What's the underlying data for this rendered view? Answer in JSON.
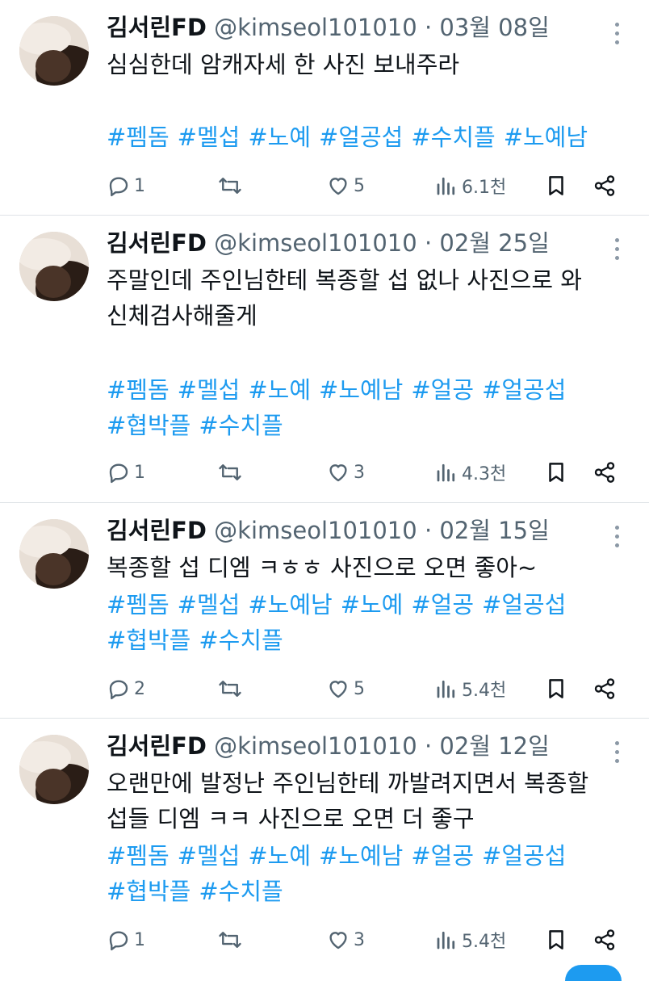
{
  "tweets": [
    {
      "name": "김서린FD",
      "handle": "@kimseol101010",
      "dot": "·",
      "date": "03월 08일",
      "text_lines": [
        "심심한데 암캐자세 한 사진 보내주라",
        ""
      ],
      "tags": [
        "#펨돔",
        "#멜섭",
        "#노예",
        "#얼공섭",
        "#수치플",
        "#노예남"
      ],
      "replies": "1",
      "retweets": "",
      "likes": "5",
      "views": "6.1천"
    },
    {
      "name": "김서린FD",
      "handle": "@kimseol101010",
      "dot": "·",
      "date": "02월 25일",
      "text_lines": [
        "주말인데 주인님한테 복종할 섭 없나 사진으로 와",
        "신체검사해줄게"
      ],
      "tags": [
        "#펨돔",
        "#멜섭",
        "#노예",
        "#노예남",
        "#얼공",
        "#얼공섭",
        "#협박플",
        "#수치플"
      ],
      "replies": "1",
      "retweets": "",
      "likes": "3",
      "views": "4.3천"
    },
    {
      "name": "김서린FD",
      "handle": "@kimseol101010",
      "dot": "·",
      "date": "02월 15일",
      "text_lines": [
        "복종할 섭 디엠 ㅋㅎㅎ 사진으로 오면 좋아~"
      ],
      "tags": [
        "#펨돔",
        "#멜섭",
        "#노예남",
        "#노예",
        "#얼공",
        "#얼공섭",
        "#협박플",
        "#수치플"
      ],
      "replies": "2",
      "retweets": "",
      "likes": "5",
      "views": "5.4천"
    },
    {
      "name": "김서린FD",
      "handle": "@kimseol101010",
      "dot": "·",
      "date": "02월 12일",
      "text_lines": [
        "오랜만에 발정난 주인님한테 까발려지면서 복종할",
        "섭들 디엠 ㅋㅋ 사진으로 오면 더 좋구"
      ],
      "tags": [
        "#펨돔",
        "#멜섭",
        "#노예",
        "#노예남",
        "#얼공",
        "#얼공섭",
        "#협박플",
        "#수치플"
      ],
      "replies": "1",
      "retweets": "",
      "likes": "3",
      "views": "5.4천"
    }
  ],
  "icons": {
    "reply": "reply-icon",
    "retweet": "retweet-icon",
    "like": "heart-icon",
    "views": "views-icon",
    "bookmark": "bookmark-icon",
    "share": "share-icon",
    "more": "more-icon"
  },
  "colors": {
    "hashtag": "#1d9bf0",
    "secondary": "#536471",
    "divider": "#dfe3e7"
  }
}
